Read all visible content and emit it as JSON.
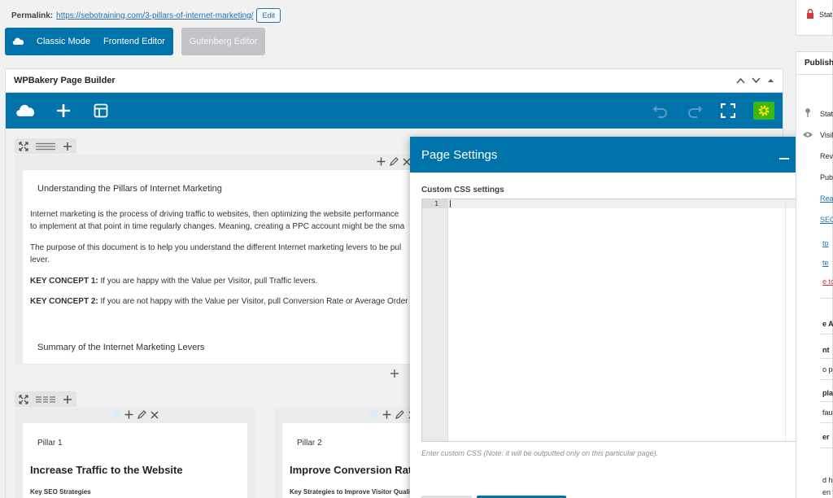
{
  "permalink": {
    "label": "Permalink:",
    "url": "https://sebotraining.com/3-pillars-of-internet-marketing/",
    "edit_label": "Edit"
  },
  "mode_bar": {
    "classic": "Classic Mode",
    "frontend": "Frontend Editor",
    "gutenberg": "Gutenberg Editor"
  },
  "wpbakery": {
    "title": "WPBakery Page Builder",
    "rows": [
      {
        "heading1": "Understanding the Pillars of Internet Marketing",
        "paragraphs": [
          "Internet marketing is the process of driving traffic to websites, then optimizing the website performance",
          "to implement at that point in time regularly changes. Meaning, creating a PPC account might be the sma",
          "The purpose of this document is to help you understand the different Internet marketing levers to be pul",
          "lever."
        ],
        "concepts": [
          {
            "key": "KEY CONCEPT 1:",
            "text": " If you are happy with the Value per Visitor, pull Traffic levers."
          },
          {
            "key": "KEY CONCEPT 2:",
            "text": " If you are not happy with the Value per Visitor, pull Conversion Rate or Average Order V"
          }
        ],
        "heading2": "Summary of the Internet Marketing Levers"
      }
    ],
    "pillars": [
      {
        "label": "Pillar 1",
        "title": "Increase Traffic to the Website",
        "subtitle": "Key SEO Strategies"
      },
      {
        "label": "Pillar 2",
        "title": "Improve Conversion Rate",
        "subtitle": "Key Strategies to Improve Visitor Quali"
      }
    ]
  },
  "page_settings": {
    "title": "Page Settings",
    "css_label": "Custom CSS settings",
    "line_number": "1",
    "help_text": "Enter custom CSS (Note: it will be outputted only on this particular page)."
  },
  "sidebar": {
    "status_top": "Stat",
    "publish": "Publish",
    "items": [
      "Stat",
      "Visil",
      "Revi",
      "Pub",
      "Rea",
      "SEO"
    ],
    "links": [
      "to",
      "te",
      "e to"
    ],
    "page_attrs": "e A",
    "attr_rows": [
      "nt",
      "o pa",
      "plat",
      "fau",
      "er"
    ],
    "bottom": [
      "d he",
      "en t"
    ]
  },
  "colors": {
    "wp_blue": "#0073aa",
    "link": "#2271b1",
    "red": "#d63638",
    "gear_green": "#3ab814"
  },
  "icons": [
    "logo-cloud-icon",
    "add-element-icon",
    "templates-icon",
    "undo-icon",
    "redo-icon",
    "fullscreen-icon",
    "gear-icon",
    "lock-icon",
    "pin-icon",
    "eye-icon",
    "minimize-icon",
    "close-icon",
    "chevron-up-icon",
    "chevron-down-icon",
    "triangle-up-icon"
  ]
}
